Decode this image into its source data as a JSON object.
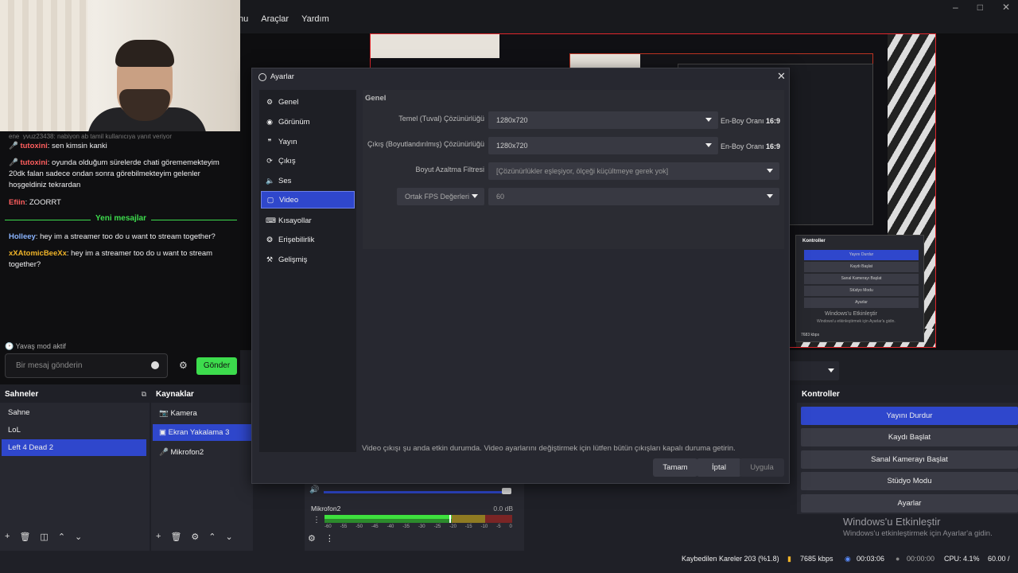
{
  "menu": {
    "items": [
      "nu",
      "Araçlar",
      "Yardım"
    ]
  },
  "chat": {
    "partial_top": "ene_yvuz23438: nabiyon ab tamil kullanıcıya yanıt veriyor",
    "messages": [
      {
        "user": "tutoxini",
        "text": ": sen kimsin kanki"
      },
      {
        "user": "tutoxini",
        "text": ": oyunda olduğum sürelerde chati görememekteyim 20dk falan sadece ondan sonra görebilmekteyim gelenler hoşgeldiniz tekrardan"
      },
      {
        "user": "Efiin",
        "text": ": ZOORRT"
      },
      {
        "user": "Holleey",
        "text": ": hey im a streamer too do u want to stream together?"
      },
      {
        "user": "xXAtomicBeeXx",
        "text": ": hey im a streamer too do u want to stream together?"
      }
    ],
    "new_messages_label": "Yeni mesajlar",
    "slow_mode": "Yavaş mod aktif",
    "input_placeholder": "Bir mesaj gönderin",
    "send_label": "Gönder"
  },
  "preview": {
    "mini_controls_title": "Kontroller",
    "mini_buttons": [
      "Yayını Durdur",
      "Kaydı Başlat",
      "Sanal Kamerayı Başlat",
      "Stüdyo Modu",
      "Ayarlar"
    ],
    "mini_watermark": "Windows'u Etkinleştir",
    "mini_watermark_sub": "Windows'u etkinleştirmek için Ayarlar'a gidin.",
    "mini_status": "7683 kbps"
  },
  "scenes": {
    "title": "Sahneler",
    "items": [
      "Sahne",
      "LoL",
      "Left 4 Dead 2"
    ],
    "selected": "Left 4 Dead 2"
  },
  "sources": {
    "title": "Kaynaklar",
    "items": [
      {
        "label": "Kamera",
        "icon": "camera-icon"
      },
      {
        "label": "Ekran Yakalama 3",
        "icon": "monitor-icon"
      },
      {
        "label": "Mikrofon2",
        "icon": "microphone-icon"
      }
    ],
    "selected": "Ekran Yakalama 3"
  },
  "mixer": {
    "channel": "Mikrofon2",
    "db": "0.0 dB",
    "ticks": [
      "-60",
      "-55",
      "-50",
      "-45",
      "-40",
      "-35",
      "-30",
      "-25",
      "-20",
      "-15",
      "-10",
      "-5",
      "0"
    ],
    "level": 0.68
  },
  "controls": {
    "title": "Kontroller",
    "buttons": [
      "Yayını Durdur",
      "Kaydı Başlat",
      "Sanal Kamerayı Başlat",
      "Stüdyo Modu",
      "Ayarlar"
    ],
    "active": "Yayını Durdur"
  },
  "watermark": {
    "title": "Windows'u Etkinleştir",
    "subtitle": "Windows'u etkinleştirmek için Ayarlar'a gidin."
  },
  "status": {
    "dropped": "Kaybedilen Kareler 203 (%1.8)",
    "bitrate": "7685 kbps",
    "stream_time": "00:03:06",
    "rec_time": "00:00:00",
    "cpu": "CPU: 4.1%",
    "fps": "60.00 /"
  },
  "dialog": {
    "title": "Ayarlar",
    "sidebar": [
      {
        "label": "Genel",
        "icon": "gear-icon"
      },
      {
        "label": "Görünüm",
        "icon": "palette-icon"
      },
      {
        "label": "Yayın",
        "icon": "broadcast-icon"
      },
      {
        "label": "Çıkış",
        "icon": "output-icon"
      },
      {
        "label": "Ses",
        "icon": "speaker-icon"
      },
      {
        "label": "Video",
        "icon": "monitor-icon"
      },
      {
        "label": "Kısayollar",
        "icon": "keyboard-icon"
      },
      {
        "label": "Erişebilirlik",
        "icon": "accessibility-icon"
      },
      {
        "label": "Gelişmiş",
        "icon": "wrench-icon"
      }
    ],
    "selected": "Video",
    "section": "Genel",
    "base_res_label": "Temel (Tuval) Çözünürlüğü",
    "base_res_value": "1280x720",
    "output_res_label": "Çıkış (Boyutlandırılmış) Çözünürlüğü",
    "output_res_value": "1280x720",
    "aspect_label": "En-Boy Oranı",
    "aspect_value": "16:9",
    "downscale_label": "Boyut Azaltma Filtresi",
    "downscale_value": "[Çözünürlükler eşleşiyor, ölçeği küçültmeye gerek yok]",
    "fps_type": "Ortak FPS Değerleri",
    "fps_value": "60",
    "note": "Video çıkışı şu anda etkin durumda. Video ayarlarını değiştirmek için lütfen bütün çıkışları kapalı duruma getirin.",
    "ok": "Tamam",
    "cancel": "İptal",
    "apply": "Uygula"
  }
}
